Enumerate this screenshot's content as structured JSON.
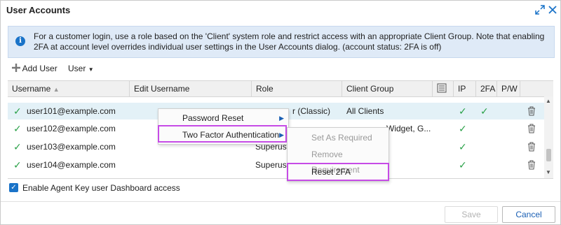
{
  "dialog": {
    "title": "User Accounts"
  },
  "info": {
    "text": "For a customer login, use a role based on the 'Client' system role and restrict access with an appropriate Client Group. Note that enabling 2FA at account level overrides individual user settings in the User Accounts dialog. (account status: 2FA is off)"
  },
  "toolbar": {
    "add_user": "Add User",
    "user_menu": "User"
  },
  "grid": {
    "headers": {
      "username": "Username",
      "edit_username": "Edit Username",
      "role": "Role",
      "client_group": "Client Group",
      "ip": "IP",
      "twofa": "2FA",
      "pw": "P/W"
    },
    "rows": [
      {
        "username": "user101@example.com",
        "role": "r (Classic)",
        "client_group": "All Clients",
        "ip": true,
        "twofa": true
      },
      {
        "username": "user102@example.com",
        "role": "",
        "client_group": "Widget, G...",
        "ip": true,
        "twofa": false
      },
      {
        "username": "user103@example.com",
        "role": "Superuse",
        "client_group": "",
        "ip": true,
        "twofa": false
      },
      {
        "username": "user104@example.com",
        "role": "Superuse",
        "client_group": "",
        "ip": true,
        "twofa": false
      }
    ]
  },
  "context_menu": {
    "items": [
      "Password Reset",
      "Two Factor Authentication"
    ]
  },
  "submenu": {
    "items": [
      "Set As Required",
      "Remove Requirement",
      "Reset 2FA"
    ]
  },
  "options": {
    "agent_key_label": "Enable Agent Key user Dashboard access",
    "agent_key_checked": true
  },
  "footer": {
    "save": "Save",
    "cancel": "Cancel"
  },
  "colors": {
    "accent": "#1a73c8",
    "check": "#2aa148",
    "highlight": "#c64be6",
    "info_bg": "#dfeaf7",
    "selected_row": "#e3f1f7"
  }
}
